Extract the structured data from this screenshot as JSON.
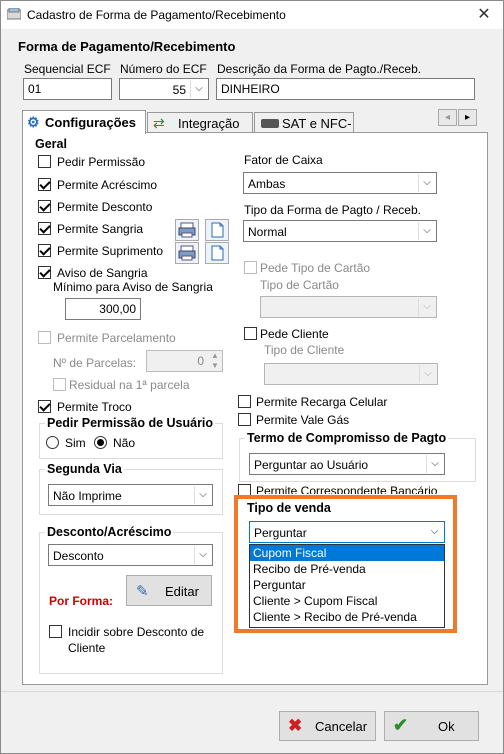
{
  "window": {
    "title": "Cadastro de Forma de Pagamento/Recebimento",
    "close_symbol": "✕"
  },
  "header": {
    "section_title": "Forma de Pagamento/Recebimento",
    "sequencial_label": "Sequencial ECF",
    "sequencial_value": "01",
    "numero_label": "Número do ECF",
    "numero_value": "55",
    "descricao_label": "Descrição da Forma de Pagto./Receb.",
    "descricao_value": "DINHEIRO"
  },
  "tabs": [
    {
      "label": "Configurações",
      "active": true,
      "icon": "gear-icon"
    },
    {
      "label": "Integração",
      "active": false,
      "icon": "integration-icon"
    },
    {
      "label": "SAT e NFC-e",
      "active": false,
      "icon": "sat-device-icon"
    }
  ],
  "geral": {
    "title": "Geral",
    "pedir_permissao": {
      "label": "Pedir Permissão",
      "checked": false
    },
    "permite_acrescimo": {
      "label": "Permite Acréscimo",
      "checked": true
    },
    "permite_desconto": {
      "label": "Permite Desconto",
      "checked": true
    },
    "permite_sangria": {
      "label": "Permite Sangria",
      "checked": true
    },
    "permite_suprimento": {
      "label": "Permite Suprimento",
      "checked": true
    },
    "aviso_sangria": {
      "label": "Aviso de Sangria",
      "checked": true
    },
    "minimo_label": "Mínimo para Aviso de Sangria",
    "minimo_value": "300,00",
    "permite_parcelamento": {
      "label": "Permite Parcelamento",
      "checked": false
    },
    "num_parcelas_label": "Nº de Parcelas:",
    "num_parcelas_value": "0",
    "residual": {
      "label": "Residual na 1ª parcela",
      "checked": false
    },
    "permite_troco": {
      "label": "Permite Troco",
      "checked": true
    }
  },
  "permissao_usuario": {
    "title": "Pedir Permissão de Usuário",
    "sim": "Sim",
    "nao": "Não",
    "selected": "Não"
  },
  "segunda_via": {
    "title": "Segunda Via",
    "value": "Não Imprime"
  },
  "desconto_acrescimo": {
    "title": "Desconto/Acréscimo",
    "value": "Desconto",
    "por_forma_label": "Por Forma:",
    "editar_label": "Editar",
    "incidir_label_1": "Incidir sobre Desconto de",
    "incidir_label_2": "Cliente",
    "incidir_checked": false
  },
  "right": {
    "fator_caixa_label": "Fator de Caixa",
    "fator_caixa_value": "Ambas",
    "tipo_forma_label": "Tipo da Forma de Pagto / Receb.",
    "tipo_forma_value": "Normal",
    "pede_tipo_cartao": {
      "label": "Pede Tipo de Cartão",
      "checked": false
    },
    "tipo_cartao_label": "Tipo de Cartão",
    "pede_cliente": {
      "label": "Pede Cliente",
      "checked": false
    },
    "tipo_cliente_label": "Tipo de Cliente",
    "recarga_celular": {
      "label": "Permite Recarga Celular",
      "checked": false
    },
    "vale_gas": {
      "label": "Permite Vale Gás",
      "checked": false
    },
    "termo_title": "Termo de Compromisso de Pagto",
    "termo_value": "Perguntar ao Usuário",
    "correspondente": {
      "label": "Permite Correspondente Bancário",
      "checked": false
    }
  },
  "tipo_venda": {
    "title": "Tipo de venda",
    "value": "Perguntar",
    "options": [
      "Cupom Fiscal",
      "Recibo de Pré-venda",
      "Perguntar",
      "Cliente > Cupom Fiscal",
      "Cliente > Recibo de Pré-venda"
    ],
    "highlighted": "Cupom Fiscal",
    "highlight_color": "#f07a28"
  },
  "footer": {
    "cancel_label": "Cancelar",
    "ok_label": "Ok"
  },
  "colors": {
    "accent": "#0078d7",
    "por_forma_red": "#d00000"
  }
}
